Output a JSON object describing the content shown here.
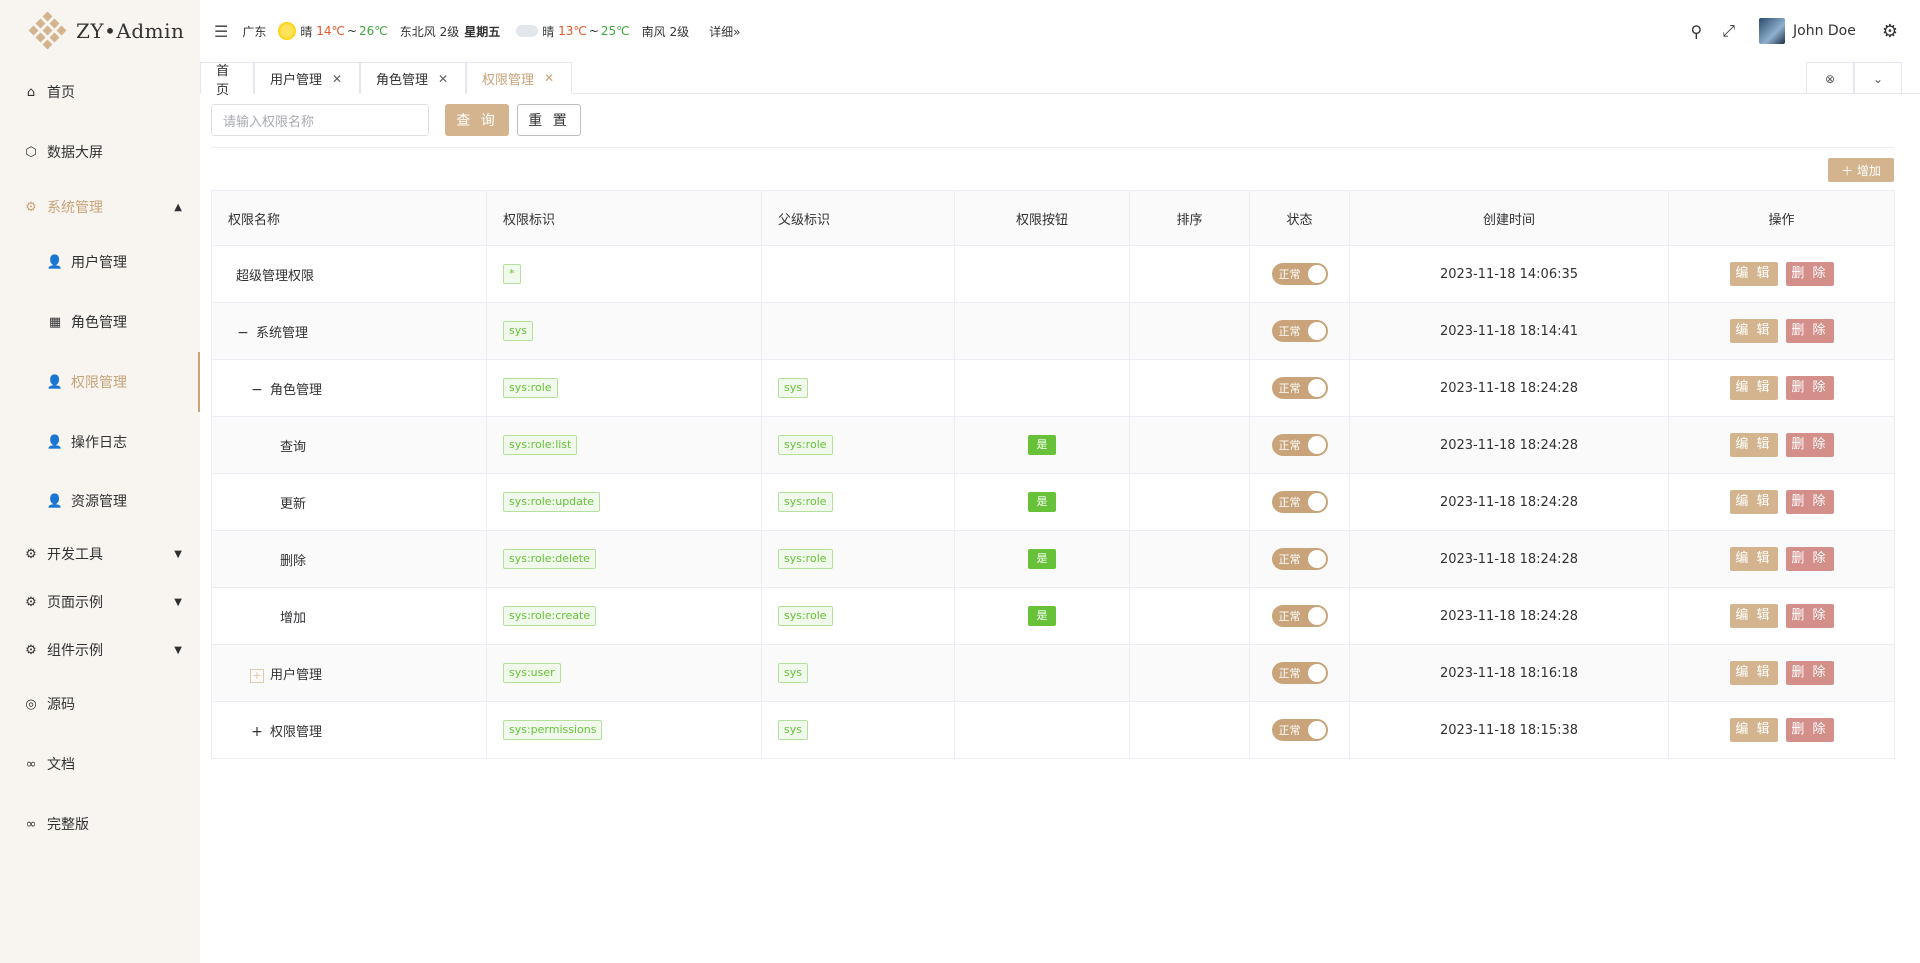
{
  "app": {
    "title": "ZY•Admin"
  },
  "sidebar": {
    "items": [
      {
        "label": "首页",
        "icon": "home-icon"
      },
      {
        "label": "数据大屏",
        "icon": "screen-icon"
      },
      {
        "label": "系统管理",
        "icon": "gear-icon"
      },
      {
        "label": "用户管理",
        "icon": "user-icon"
      },
      {
        "label": "角色管理",
        "icon": "grid-icon"
      },
      {
        "label": "权限管理",
        "icon": "user-icon"
      },
      {
        "label": "操作日志",
        "icon": "user-icon"
      },
      {
        "label": "资源管理",
        "icon": "user-icon"
      },
      {
        "label": "开发工具",
        "icon": "gear-icon"
      },
      {
        "label": "页面示例",
        "icon": "gear-icon"
      },
      {
        "label": "组件示例",
        "icon": "gear-icon"
      },
      {
        "label": "源码",
        "icon": "github-icon"
      },
      {
        "label": "文档",
        "icon": "link-icon"
      },
      {
        "label": "完整版",
        "icon": "link-icon"
      }
    ]
  },
  "header": {
    "weather": {
      "city": "广东",
      "today": {
        "desc": "晴",
        "low": "14℃",
        "high": "26℃",
        "wind": "东北风 2级"
      },
      "weekday": "星期五",
      "tomorrow": {
        "desc": "晴",
        "low": "13℃",
        "high": "25℃",
        "wind": "南风 2级"
      },
      "more": "详细»"
    },
    "user": "John Doe"
  },
  "tabs": [
    "首页",
    "用户管理",
    "角色管理",
    "权限管理"
  ],
  "search": {
    "placeholder": "请输入权限名称",
    "query": "查 询",
    "reset": "重 置",
    "add": "＋ 增加"
  },
  "table": {
    "columns": [
      "权限名称",
      "权限标识",
      "父级标识",
      "权限按钮",
      "排序",
      "状态",
      "创建时间",
      "操作"
    ],
    "status_label": "正常",
    "edit_label": "编 辑",
    "delete_label": "删 除",
    "rows": [
      {
        "name": "超级管理权限",
        "code": "*",
        "parent": "",
        "button": "",
        "sort": "",
        "time": "2023-11-18 14:06:35"
      },
      {
        "name": "系统管理",
        "code": "sys",
        "parent": "",
        "button": "",
        "sort": "",
        "time": "2023-11-18 18:14:41"
      },
      {
        "name": "角色管理",
        "code": "sys:role",
        "parent": "sys",
        "button": "",
        "sort": "",
        "time": "2023-11-18 18:24:28"
      },
      {
        "name": "查询",
        "code": "sys:role:list",
        "parent": "sys:role",
        "button": "是",
        "sort": "",
        "time": "2023-11-18 18:24:28"
      },
      {
        "name": "更新",
        "code": "sys:role:update",
        "parent": "sys:role",
        "button": "是",
        "sort": "",
        "time": "2023-11-18 18:24:28"
      },
      {
        "name": "删除",
        "code": "sys:role:delete",
        "parent": "sys:role",
        "button": "是",
        "sort": "",
        "time": "2023-11-18 18:24:28"
      },
      {
        "name": "增加",
        "code": "sys:role:create",
        "parent": "sys:role",
        "button": "是",
        "sort": "",
        "time": "2023-11-18 18:24:28"
      },
      {
        "name": "用户管理",
        "code": "sys:user",
        "parent": "sys",
        "button": "",
        "sort": "",
        "time": "2023-11-18 18:16:18"
      },
      {
        "name": "权限管理",
        "code": "sys:permissions",
        "parent": "sys",
        "button": "",
        "sort": "",
        "time": "2023-11-18 18:15:38"
      }
    ]
  },
  "colors": {
    "accent": "#c9a37a",
    "button": "#d3b48e",
    "danger": "#d48f8a",
    "tag_green": "#67c23a",
    "sidebar_bg": "#f8f5f0"
  }
}
